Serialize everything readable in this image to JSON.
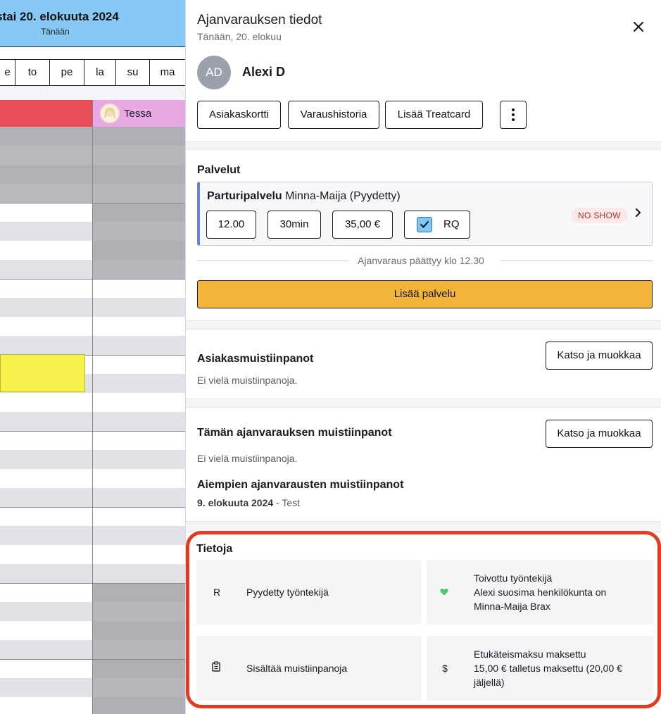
{
  "calendar": {
    "date_title": "stai 20. elokuuta 2024",
    "today_label": "Tänään",
    "weekdays": [
      "e",
      "to",
      "pe",
      "la",
      "su",
      "ma"
    ],
    "staff": {
      "tessa_name": "Tessa"
    }
  },
  "panel": {
    "title": "Ajanvarauksen tiedot",
    "subtitle": "Tänään, 20. elokuu",
    "close_icon": "close-icon",
    "client": {
      "initials": "AD",
      "name": "Alexi D"
    },
    "actions": {
      "client_card": "Asiakaskortti",
      "booking_history": "Varaushistoria",
      "add_treatcard": "Lisää Treatcard",
      "more_icon": "more-vertical-icon"
    },
    "services": {
      "heading": "Palvelut",
      "service_name": "Parturipalvelu",
      "employee_text": "Minna-Maija (Pyydetty)",
      "time": "12.00",
      "duration": "30min",
      "price": "35,00 €",
      "requested_label": "RQ",
      "requested_checked": true,
      "status_badge": "NO SHOW",
      "ends_text": "Ajanvaraus päättyy klo 12.30",
      "add_service": "Lisää palvelu",
      "accent_color": "#f2b53a"
    },
    "client_notes": {
      "heading": "Asiakasmuistiinpanot",
      "empty": "Ei vielä muistiinpanoja.",
      "button": "Katso ja muokkaa"
    },
    "booking_notes": {
      "heading": "Tämän ajanvarauksen muistiinpanot",
      "empty": "Ei vielä muistiinpanoja.",
      "button": "Katso ja muokkaa",
      "previous_heading": "Aiempien ajanvarausten muistiinpanot",
      "previous_date": "9. elokuuta 2024",
      "previous_text": " - Test"
    },
    "info": {
      "heading": "Tietoja",
      "highlight_color": "#e23b22",
      "requested_employee": {
        "icon_letter": "R",
        "label": "Pyydetty työntekijä"
      },
      "preferred_employee": {
        "icon": "heart-icon",
        "title": "Toivottu työntekijä",
        "line1": "Alexi suosima henkilökunta on",
        "line2": "Minna-Maija Brax"
      },
      "has_notes": {
        "icon": "clipboard-icon",
        "label": "Sisältää muistiinpanoja"
      },
      "prepayment": {
        "icon_symbol": "$",
        "title": "Etukäteismaksu maksettu",
        "line1": "15,00 € talletus maksettu (20,00 €",
        "line2": "jäljellä)"
      }
    }
  }
}
